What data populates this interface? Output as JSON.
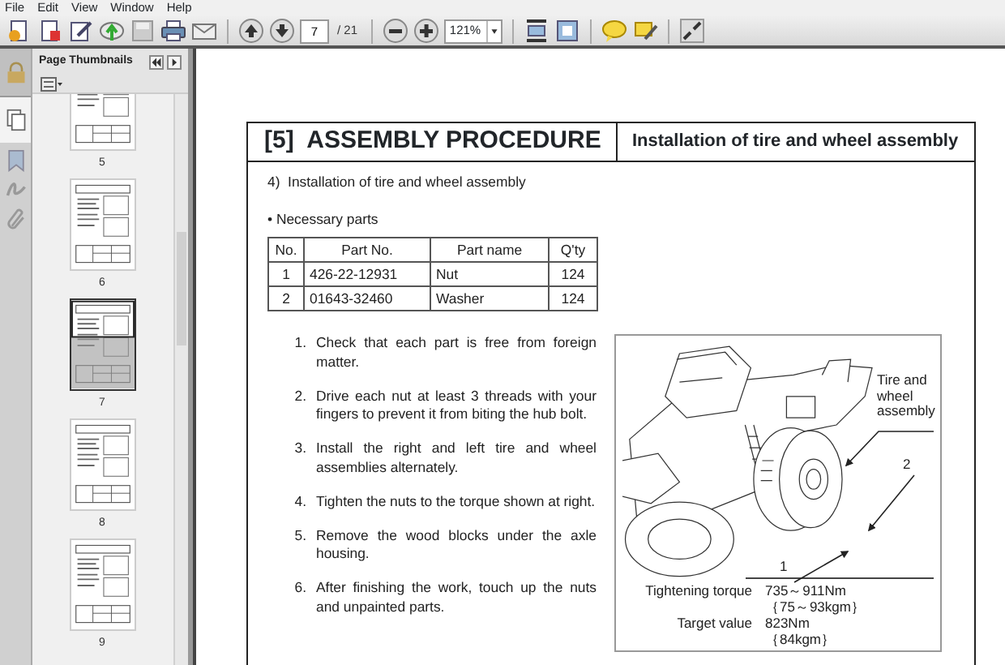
{
  "menu": [
    "File",
    "Edit",
    "View",
    "Window",
    "Help"
  ],
  "toolbar": {
    "page_field": "7",
    "page_total": "/ 21",
    "zoom_field": "121%"
  },
  "sidebar": {
    "title": "Page Thumbnails",
    "thumbnails": [
      {
        "label": "5",
        "selected": false
      },
      {
        "label": "6",
        "selected": false
      },
      {
        "label": "7",
        "selected": true
      },
      {
        "label": "8",
        "selected": false
      },
      {
        "label": "9",
        "selected": false
      }
    ]
  },
  "document": {
    "section": "[5]  ASSEMBLY PROCEDURE",
    "heading": "Installation of tire and wheel assembly",
    "subheading": "4)  Installation of tire and wheel assembly",
    "parts_label": "• Necessary parts",
    "table": {
      "columns": [
        "No.",
        "Part No.",
        "Part name",
        "Q'ty"
      ],
      "rows": [
        [
          "1",
          "426-22-12931",
          "Nut",
          "124"
        ],
        [
          "2",
          "01643-32460",
          "Washer",
          "124"
        ]
      ]
    },
    "steps": [
      {
        "number": "1.",
        "text": "Check that each part is free from foreign matter."
      },
      {
        "number": "2.",
        "text": "Drive each nut at least 3 threads with your fingers to prevent it from biting the hub bolt."
      },
      {
        "number": "3.",
        "text": "Install the right and left tire and wheel assemblies alternately."
      },
      {
        "number": "4.",
        "text": "Tighten the nuts to the torque shown at right."
      },
      {
        "number": "5.",
        "text": "Remove the wood blocks under the axle housing."
      },
      {
        "number": "6.",
        "text": "After finishing the work, touch up the nuts and unpainted parts."
      }
    ],
    "figure": {
      "callouts": [
        "Tire and wheel assembly",
        "2",
        "1"
      ],
      "specs": [
        {
          "label": "Tightening torque",
          "values": [
            "735～911Nm",
            "｛75～93kgm｝"
          ]
        },
        {
          "label": "Target value",
          "values": [
            "823Nm",
            "｛84kgm｝"
          ]
        }
      ]
    }
  }
}
